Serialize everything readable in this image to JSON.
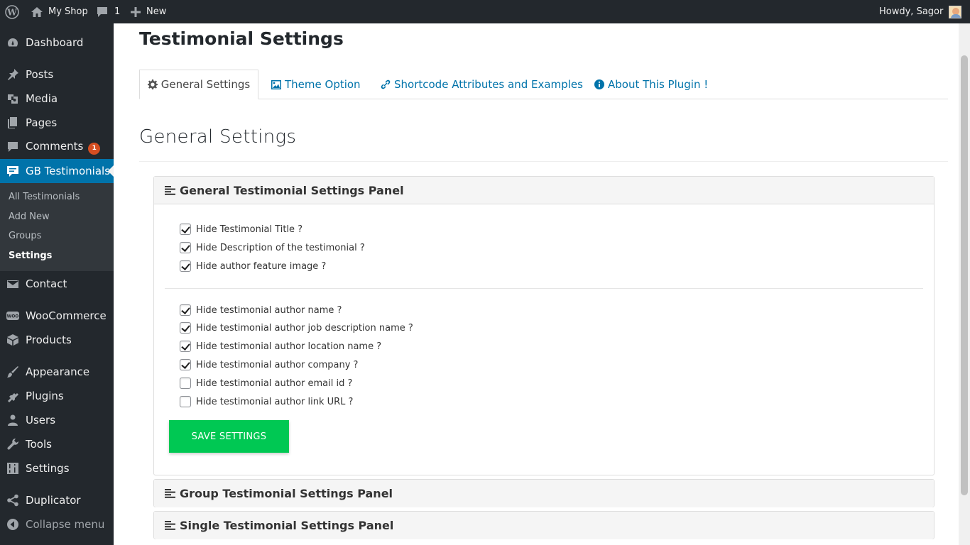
{
  "adminbar": {
    "site_name": "My Shop",
    "comments_count": "1",
    "new_label": "New",
    "howdy": "Howdy, Sagor"
  },
  "sidebar": {
    "items": [
      {
        "label": "Dashboard",
        "icon": "dashboard-icon"
      },
      {
        "label": "Posts",
        "icon": "pin-icon"
      },
      {
        "label": "Media",
        "icon": "media-icon"
      },
      {
        "label": "Pages",
        "icon": "pages-icon"
      },
      {
        "label": "Comments",
        "icon": "comment-icon",
        "badge": "1"
      },
      {
        "label": "GB Testimonials",
        "icon": "testimonial-icon"
      },
      {
        "label": "Contact",
        "icon": "mail-icon"
      },
      {
        "label": "WooCommerce",
        "icon": "woo-icon"
      },
      {
        "label": "Products",
        "icon": "box-icon"
      },
      {
        "label": "Appearance",
        "icon": "brush-icon"
      },
      {
        "label": "Plugins",
        "icon": "plug-icon"
      },
      {
        "label": "Users",
        "icon": "user-icon"
      },
      {
        "label": "Tools",
        "icon": "wrench-icon"
      },
      {
        "label": "Settings",
        "icon": "sliders-icon"
      },
      {
        "label": "Duplicator",
        "icon": "share-icon"
      },
      {
        "label": "Collapse menu",
        "icon": "collapse-icon"
      }
    ],
    "submenu": [
      "All Testimonials",
      "Add New",
      "Groups",
      "Settings"
    ]
  },
  "main": {
    "page_title": "Testimonial Settings",
    "tabs": [
      {
        "label": "General Settings",
        "icon": "gear-icon"
      },
      {
        "label": "Theme Option",
        "icon": "image-icon"
      },
      {
        "label": "Shortcode Attributes and Examples",
        "icon": "link-icon"
      },
      {
        "label": "About This Plugin !",
        "icon": "info-icon"
      }
    ],
    "section_title": "General Settings",
    "panels": [
      {
        "title": "General Testimonial Settings Panel"
      },
      {
        "title": "Group Testimonial Settings Panel"
      },
      {
        "title": "Single Testimonial Settings Panel"
      }
    ],
    "options": [
      {
        "label": "Hide Testimonial Title ?",
        "checked": true
      },
      {
        "label": "Hide Description of the testimonial ?",
        "checked": true
      },
      {
        "label": "Hide author feature image ?",
        "checked": true
      },
      {
        "label": "Hide testimonial author name ?",
        "checked": true
      },
      {
        "label": "Hide testimonial author job description name ?",
        "checked": true
      },
      {
        "label": "Hide testimonial author location name ?",
        "checked": true
      },
      {
        "label": "Hide testimonial author company ?",
        "checked": true
      },
      {
        "label": "Hide testimonial author email id ?",
        "checked": false
      },
      {
        "label": "Hide testimonial author link URL ?",
        "checked": false
      }
    ],
    "save_label": "SAVE SETTINGS"
  },
  "colors": {
    "accent": "#0073aa",
    "save_button": "#00c853",
    "badge": "#d54e21",
    "sidebar_bg": "#23282d"
  }
}
